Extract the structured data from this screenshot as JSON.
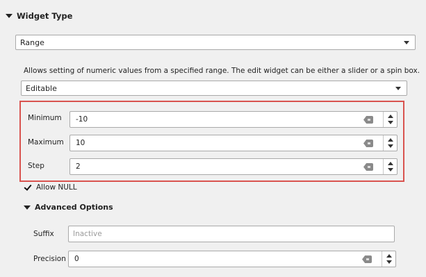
{
  "widget_type": {
    "header": "Widget Type",
    "combo_value": "Range",
    "description": "Allows setting of numeric values from a specified range. The edit widget can be either a slider or a spin box.",
    "mode_value": "Editable"
  },
  "range": {
    "minimum": {
      "label": "Minimum",
      "value": "-10"
    },
    "maximum": {
      "label": "Maximum",
      "value": "10"
    },
    "step": {
      "label": "Step",
      "value": "2"
    }
  },
  "allow_null": {
    "label": "Allow NULL",
    "checked": true
  },
  "advanced": {
    "header": "Advanced Options",
    "suffix": {
      "label": "Suffix",
      "placeholder": "Inactive"
    },
    "precision": {
      "label": "Precision",
      "value": "0"
    }
  },
  "colors": {
    "highlight_border": "#d9534f"
  }
}
